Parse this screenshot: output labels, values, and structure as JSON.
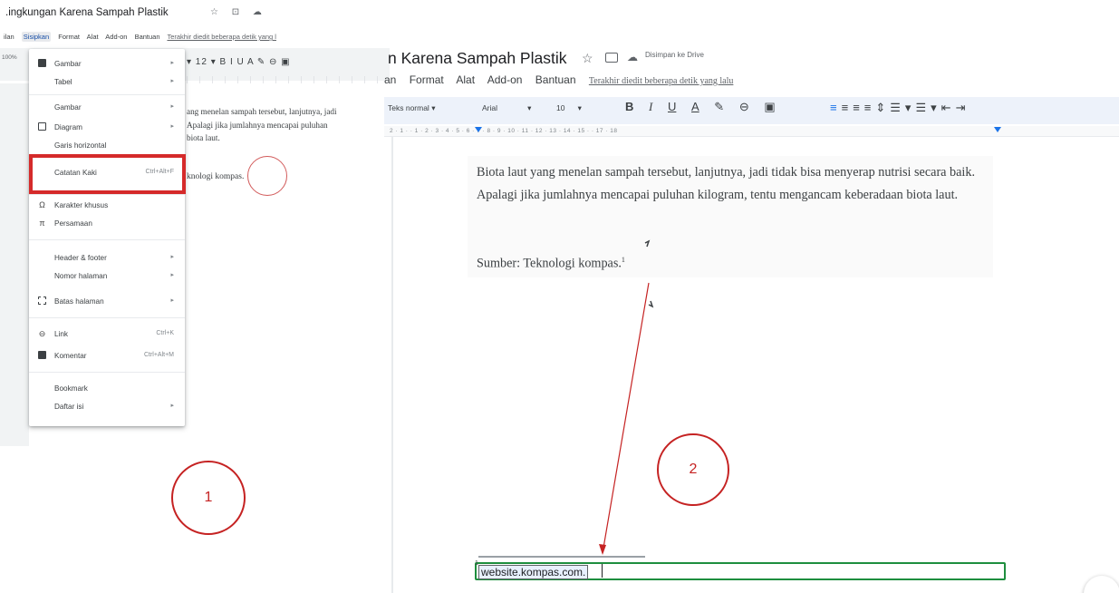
{
  "left_screenshot": {
    "doc_title": ".ingkungan Karena Sampah Plastik",
    "title_icons": "☆ ⊡ ☁",
    "menubar": [
      "ilan",
      "Sisipkan",
      "Format",
      "Alat",
      "Add-on",
      "Bantuan"
    ],
    "last_edit": "Terakhir diedit beberapa detik yang l",
    "zoom": "100%",
    "toolbar_glyphs": "▾ 12 ▾ B I U A ✎ ⊖ ▣",
    "doc_lines": [
      "ang menelan sampah tersebut, lanjutnya, jadi",
      "Apalagi jika jumlahnya mencapai puluhan",
      "biota laut."
    ],
    "doc_source_fragment": "knologi kompas."
  },
  "insert_menu": {
    "items": [
      {
        "icon": "image-icon",
        "label": "Gambar",
        "submenu": true
      },
      {
        "label": "Tabel",
        "submenu": true
      },
      {
        "label": "Gambar",
        "submenu": true
      },
      {
        "icon": "diagram-icon",
        "label": "Diagram",
        "submenu": true
      },
      {
        "label": "Garis horizontal"
      },
      {
        "label": "Catatan Kaki",
        "shortcut": "Ctrl+Alt+F"
      },
      {
        "icon": "omega-icon",
        "label": "Karakter khusus"
      },
      {
        "icon": "pi-icon",
        "label": "Persamaan"
      },
      {
        "label": "Header & footer",
        "submenu": true
      },
      {
        "label": "Nomor halaman",
        "submenu": true
      },
      {
        "icon": "page-break-icon",
        "label": "Batas halaman",
        "submenu": true
      },
      {
        "icon": "link-icon",
        "label": "Link",
        "shortcut": "Ctrl+K"
      },
      {
        "icon": "comment-icon",
        "label": "Komentar",
        "shortcut": "Ctrl+Alt+M"
      },
      {
        "label": "Bookmark"
      },
      {
        "label": "Daftar isi",
        "submenu": true
      }
    ]
  },
  "annotations": {
    "step1": "1",
    "step2": "2",
    "highlight_color": "#d52a2a"
  },
  "right_screenshot": {
    "doc_title": "n Karena Sampah Plastik",
    "saved_status": "Disimpan ke Drive",
    "menubar": [
      "an",
      "Format",
      "Alat",
      "Add-on",
      "Bantuan"
    ],
    "last_edit": "Terakhir diedit beberapa detik yang lalu",
    "style_select": "Teks normal",
    "font_select": "Arial",
    "size_select": "10",
    "ruler_labels": "2 · 1 · · 1 · 2 · 3 · 4 · 5 · 6 · 7 · 8 · 9 · 10 · 11 · 12 · 13 · 14 · 15 · · 17 · 18",
    "paragraph": "Biota laut yang menelan sampah tersebut, lanjutnya, jadi tidak bisa menyerap nutrisi secara baik. Apalagi jika jumlahnya mencapai puluhan kilogram, tentu mengancam keberadaan biota laut.",
    "source_text": "Sumber: Teknologi kompas.",
    "footnote_marker": "1",
    "footnote_text": "website.kompas.com."
  }
}
